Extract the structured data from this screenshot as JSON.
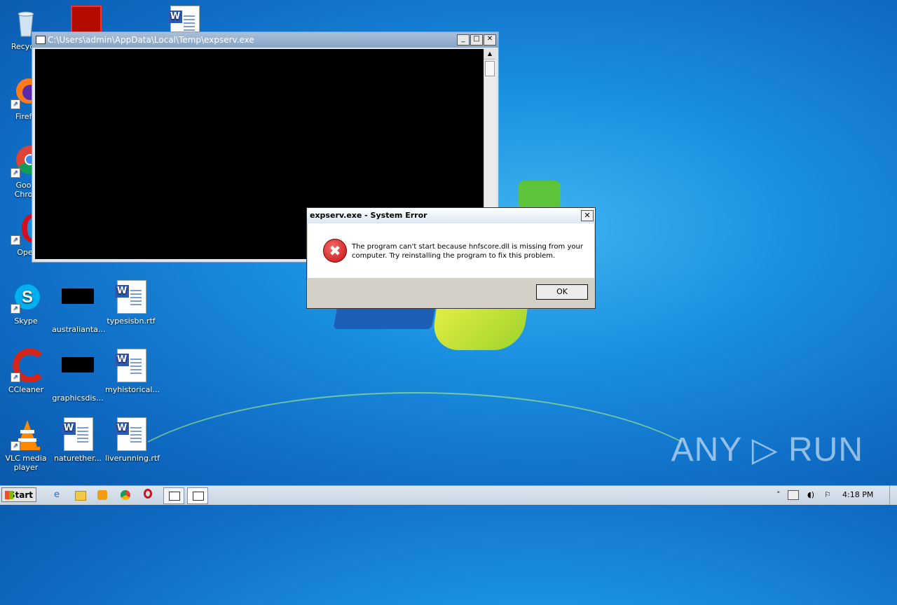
{
  "desktop": {
    "icons": [
      {
        "label": "Recycle",
        "kind": "recycle"
      },
      {
        "label": "Firefo",
        "kind": "firefox"
      },
      {
        "label": "Goog\nChron",
        "kind": "chrome"
      },
      {
        "label": "Opel",
        "kind": "opera"
      },
      {
        "label": "Skype",
        "kind": "skype"
      },
      {
        "label": "australianta...",
        "kind": "black"
      },
      {
        "label": "typesisbn.rtf",
        "kind": "doc"
      },
      {
        "label": "CCleaner",
        "kind": "ccleaner"
      },
      {
        "label": "graphicsdis...",
        "kind": "black"
      },
      {
        "label": "myhistorical...",
        "kind": "doc"
      },
      {
        "label": "VLC media\nplayer",
        "kind": "vlc"
      },
      {
        "label": "naturether...",
        "kind": "doc"
      },
      {
        "label": "liverunning.rtf",
        "kind": "doc"
      }
    ]
  },
  "console_window": {
    "title": "C:\\Users\\admin\\AppData\\Local\\Temp\\expserv.exe",
    "min_glyph": "_",
    "max_glyph": "□",
    "close_glyph": "✕"
  },
  "error_dialog": {
    "title": "expserv.exe - System Error",
    "close_glyph": "✕",
    "icon_glyph": "✖",
    "message": "The program can't start because hnfscore.dll is missing from your computer. Try reinstalling the program to fix this problem.",
    "ok_label": "OK"
  },
  "taskbar": {
    "start_label": "Start",
    "clock": "4:18 PM",
    "tray_up_glyph": "˄",
    "tray_flag_glyph": "⚐",
    "tray_speaker_glyph": "◖)"
  },
  "watermark": "ANY ▷ RUN",
  "colors": {
    "desktop_bg": "#0f6cc4",
    "console_bg": "#000000",
    "dialog_body": "#ffffff",
    "error_red": "#c21010"
  }
}
